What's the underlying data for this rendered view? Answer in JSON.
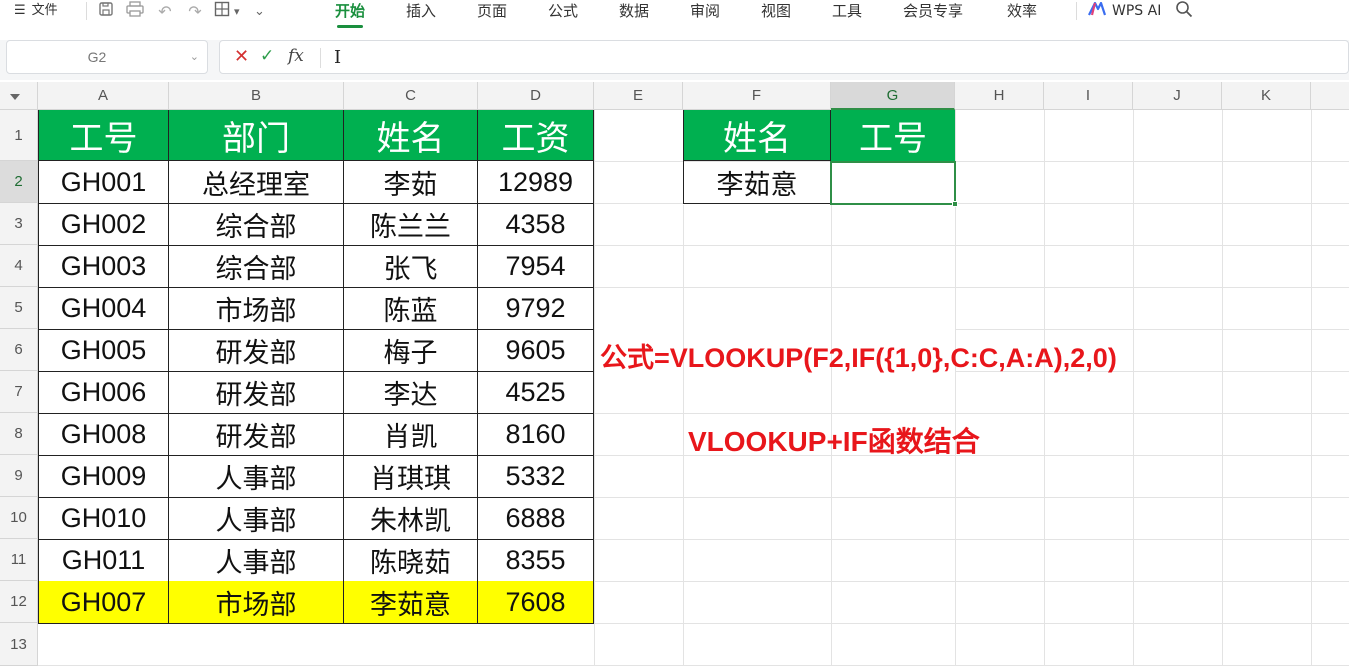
{
  "menubar": {
    "file_label": "文件",
    "tabs": [
      "开始",
      "插入",
      "页面",
      "公式",
      "数据",
      "审阅",
      "视图",
      "工具",
      "会员专享",
      "效率"
    ],
    "active_tab": "开始",
    "wps_ai_label": "WPS AI"
  },
  "formula_bar": {
    "name_box": "G2",
    "content": ""
  },
  "columns": [
    "A",
    "B",
    "C",
    "D",
    "E",
    "F",
    "G",
    "H",
    "I",
    "J",
    "K"
  ],
  "rows": [
    "1",
    "2",
    "3",
    "4",
    "5",
    "6",
    "7",
    "8",
    "9",
    "10",
    "11",
    "12",
    "13"
  ],
  "selected_cell": "G2",
  "table": {
    "headers": [
      "工号",
      "部门",
      "姓名",
      "工资"
    ],
    "rows": [
      [
        "GH001",
        "总经理室",
        "李茹",
        "12989"
      ],
      [
        "GH002",
        "综合部",
        "陈兰兰",
        "4358"
      ],
      [
        "GH003",
        "综合部",
        "张飞",
        "7954"
      ],
      [
        "GH004",
        "市场部",
        "陈蓝",
        "9792"
      ],
      [
        "GH005",
        "研发部",
        "梅子",
        "9605"
      ],
      [
        "GH006",
        "研发部",
        "李达",
        "4525"
      ],
      [
        "GH008",
        "研发部",
        "肖凯",
        "8160"
      ],
      [
        "GH009",
        "人事部",
        "肖琪琪",
        "5332"
      ],
      [
        "GH010",
        "人事部",
        "朱林凯",
        "6888"
      ],
      [
        "GH011",
        "人事部",
        "陈晓茹",
        "8355"
      ],
      [
        "GH007",
        "市场部",
        "李茹意",
        "7608"
      ]
    ],
    "highlight_row_index": 10,
    "highlight_color": "#ffff00",
    "header_color": "#00b050"
  },
  "lookup": {
    "headers": [
      "姓名",
      "工号"
    ],
    "name_value": "李茹意",
    "result_value": ""
  },
  "notes": {
    "formula": "公式=VLOOKUP(F2,IF({1,0},C:C,A:A),2,0)",
    "caption": "VLOOKUP+IF函数结合",
    "color": "#e8161b"
  }
}
